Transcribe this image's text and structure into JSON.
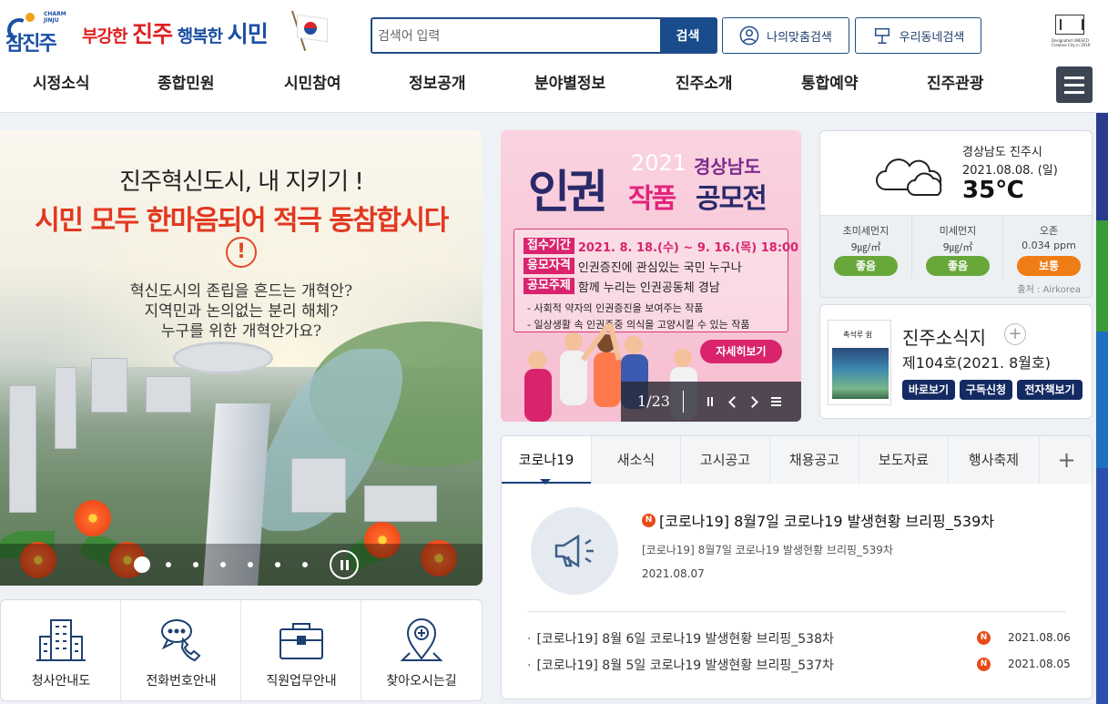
{
  "header": {
    "logo_text": "참진주",
    "logo_en": "CHARM JINJU",
    "slogan_1": "부강한 ",
    "slogan_2": "진주",
    "slogan_3": " 행복한 ",
    "slogan_4": "시민",
    "search": {
      "placeholder": "검색어 입력",
      "button": "검색"
    },
    "my_search": "나의맞춤검색",
    "town_search": "우리동네검색",
    "unesco": "Designated UNESCO Creative City in 2019"
  },
  "gnb": [
    "시정소식",
    "종합민원",
    "시민참여",
    "정보공개",
    "분야별정보",
    "진주소개",
    "통합예약",
    "진주관광"
  ],
  "banner": {
    "title1": "진주혁신도시, 내 지키기 !",
    "title2a": "시민 모두 ",
    "title2b": "한마음",
    "title2c": "되어 적극 동참합시다",
    "alert": "!",
    "line1": "혁신도시의 존립을 흔드는 개혁안?",
    "line2": "지역민과 논의없는 분리 해체?",
    "line3": "누구를 위한 개혁안가요?"
  },
  "quick": [
    "청사안내도",
    "전화번호안내",
    "직원업무안내",
    "찾아오시는길"
  ],
  "promo": {
    "year": "2021",
    "region": "경상남도",
    "title_a": "인권",
    "title_b": "작품",
    "title_c": "공모전",
    "rows": [
      {
        "tag": "접수기간",
        "text": "2021. 8. 18.(수) ~ 9. 16.(목) 18:00"
      },
      {
        "tag": "응모자격",
        "text": "인권증진에 관심있는 국민 누구나"
      },
      {
        "tag": "공모주제",
        "text": "함께 누리는 인권공동체 경남"
      }
    ],
    "bullets": [
      "- 사회적 약자의 인권증진을 보여주는 작품",
      "- 일상생활 속 인권존중 의식을 고양시킬 수 있는 작품"
    ],
    "detail_button": "자세히보기",
    "counter_current": "1",
    "counter_total": "/23"
  },
  "weather": {
    "location": "경상남도 진주시",
    "date": "2021.08.08. (일)",
    "temp": "35℃",
    "air": [
      {
        "name": "초미세먼지",
        "value": "9㎍/㎥",
        "grade": "좋음"
      },
      {
        "name": "미세먼지",
        "value": "9㎍/㎥",
        "grade": "좋음"
      },
      {
        "name": "오존",
        "value": "0.034 ppm",
        "grade": "보통"
      }
    ],
    "source": "출처 : Airkorea"
  },
  "magazine": {
    "title": "진주소식지",
    "issue": "제104호(2021. 8월호)",
    "buttons": [
      "바로보기",
      "구독신청",
      "전자책보기"
    ],
    "cover_text": "촉석루 쉼"
  },
  "news": {
    "tabs": [
      "코로나19",
      "새소식",
      "고시공고",
      "채용공고",
      "보도자료",
      "행사축제"
    ],
    "more": "+",
    "badge": "N",
    "featured": {
      "title": "[코로나19] 8월7일 코로나19 발생현황 브리핑_539차",
      "summary": "[코로나19] 8월7일 코로나19 발생현황 브리핑_539차",
      "date": "2021.08.07"
    },
    "list": [
      {
        "title": "[코로나19] 8월 6일 코로나19 발생현황 브리핑_538차",
        "date": "2021.08.06"
      },
      {
        "title": "[코로나19] 8월 5일 코로나19 발생현황 브리핑_537차",
        "date": "2021.08.05"
      }
    ]
  },
  "colors": {
    "primary": "#1a4c8c",
    "accent": "#e02020",
    "promo_pink": "#d9246d",
    "good": "#68a83a",
    "normal": "#ef7d15"
  }
}
